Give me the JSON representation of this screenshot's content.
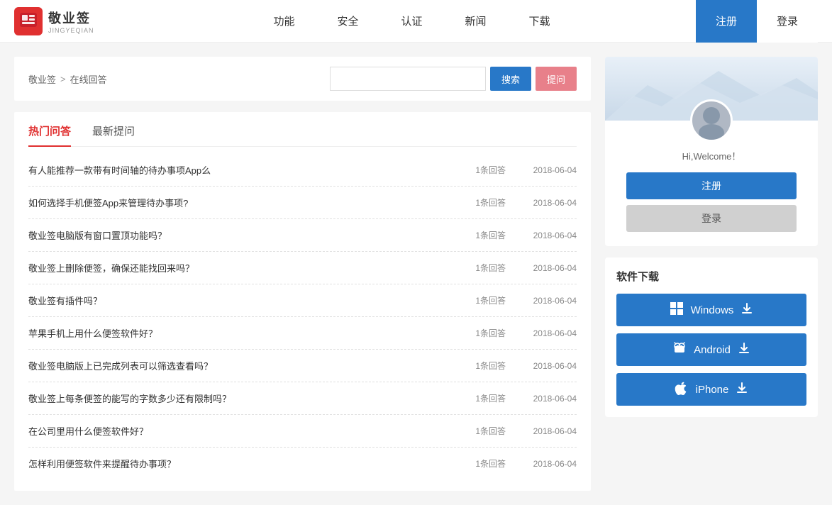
{
  "nav": {
    "logo_title": "敬业签",
    "logo_sub": "JINGYEQIAN",
    "logo_char": "签",
    "links": [
      "功能",
      "安全",
      "认证",
      "新闻",
      "下载"
    ],
    "register": "注册",
    "login": "登录"
  },
  "topbar": {
    "breadcrumb_home": "敬业签",
    "breadcrumb_sep": ">",
    "breadcrumb_current": "在线回答",
    "search_placeholder": "",
    "search_btn": "搜索",
    "ask_btn": "提问"
  },
  "tabs": [
    {
      "label": "热门问答",
      "active": true
    },
    {
      "label": "最新提问",
      "active": false
    }
  ],
  "qa_items": [
    {
      "title": "有人能推荐一款带有时间轴的待办事项App么",
      "count": "1条回答",
      "date": "2018-06-04"
    },
    {
      "title": "如何选择手机便签App来管理待办事项?",
      "count": "1条回答",
      "date": "2018-06-04"
    },
    {
      "title": "敬业签电脑版有窗口置顶功能吗？",
      "count": "1条回答",
      "date": "2018-06-04"
    },
    {
      "title": "敬业签上删除便签，确保还能找回来吗？",
      "count": "1条回答",
      "date": "2018-06-04"
    },
    {
      "title": "敬业签有插件吗？",
      "count": "1条回答",
      "date": "2018-06-04"
    },
    {
      "title": "苹果手机上用什么便签软件好？",
      "count": "1条回答",
      "date": "2018-06-04"
    },
    {
      "title": "敬业签电脑版上已完成列表可以筛选查看吗？",
      "count": "1条回答",
      "date": "2018-06-04"
    },
    {
      "title": "敬业签上每条便签的能写的字数多少还有限制吗？",
      "count": "1条回答",
      "date": "2018-06-04"
    },
    {
      "title": "在公司里用什么便签软件好？",
      "count": "1条回答",
      "date": "2018-06-04"
    },
    {
      "title": "怎样利用便签软件来提醒待办事项？",
      "count": "1条回答",
      "date": "2018-06-04"
    }
  ],
  "user_card": {
    "welcome": "Hi,Welcome！",
    "register": "注册",
    "login": "登录"
  },
  "download": {
    "title": "软件下载",
    "buttons": [
      {
        "label": "Windows",
        "icon": "⊞",
        "arrow": "⬇"
      },
      {
        "label": "Android",
        "icon": "🤖",
        "arrow": "⬇"
      },
      {
        "label": "iPhone",
        "icon": "🍎",
        "arrow": "⬇"
      }
    ]
  }
}
